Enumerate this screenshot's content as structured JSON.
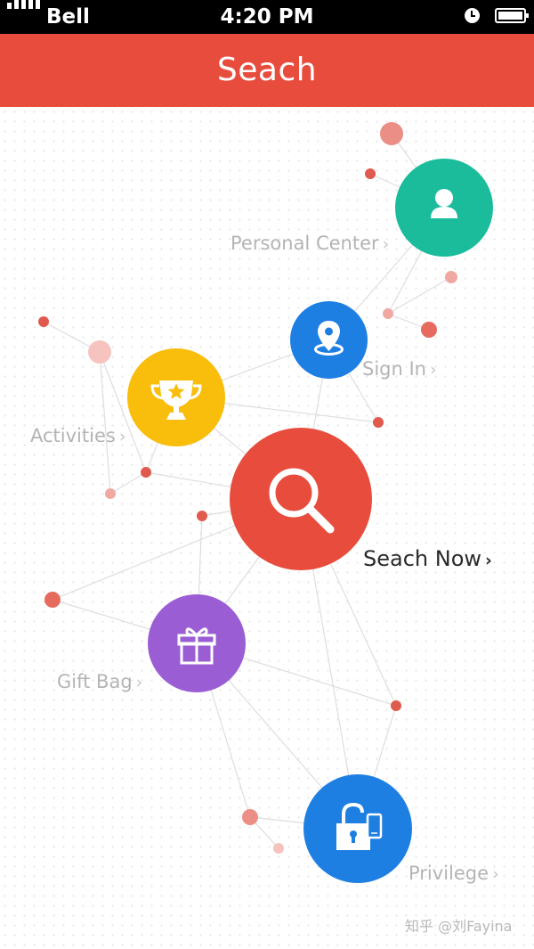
{
  "status_bar": {
    "carrier": "Bell",
    "time": "4:20 PM"
  },
  "header": {
    "title": "Seach"
  },
  "nodes": {
    "personal_center": {
      "label": "Personal Center",
      "color": "#1abc9c",
      "icon": "person-icon"
    },
    "sign_in": {
      "label": "Sign In",
      "color": "#1e7fe3",
      "icon": "location-pin-icon"
    },
    "activities": {
      "label": "Activities",
      "color": "#f9bd0c",
      "icon": "trophy-icon"
    },
    "search_now": {
      "label": "Seach Now",
      "color": "#e84c3d",
      "icon": "magnifier-icon"
    },
    "gift_bag": {
      "label": "Gift Bag",
      "color": "#9b5dd4",
      "icon": "gift-icon"
    },
    "privilege": {
      "label": "Privilege",
      "color": "#1e7fe3",
      "icon": "unlocked-padlock-phone-icon"
    }
  },
  "colors": {
    "dot_accent": "#e05a4e",
    "dot_light": "#f0a9a2",
    "line": "#dedede"
  },
  "watermark": "知乎 @刘Fayina"
}
